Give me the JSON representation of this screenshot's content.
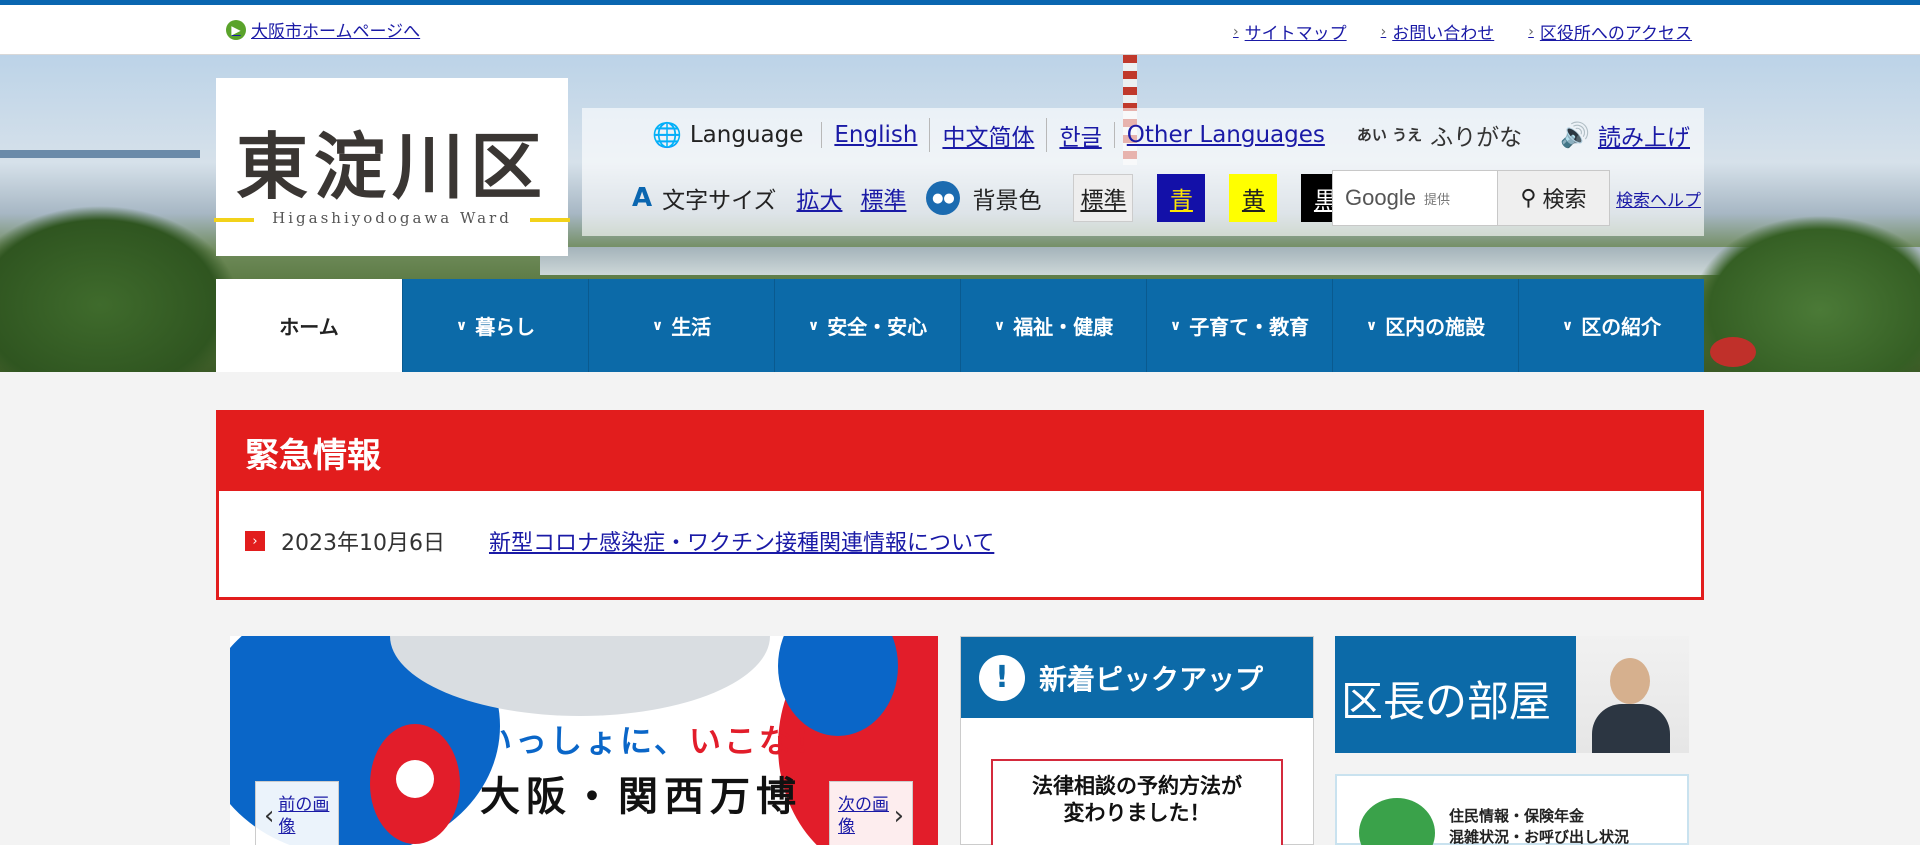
{
  "topbar": {
    "home_link": "大阪市ホームページへ",
    "links": [
      "サイトマップ",
      "お問い合わせ",
      "区役所へのアクセス"
    ]
  },
  "logo": {
    "kanji": "東淀川区",
    "roman": "Higashiyodogawa Ward"
  },
  "language": {
    "label": "Language",
    "options": [
      "English",
      "中文简体",
      "한글",
      "Other Languages"
    ],
    "furigana_icon": "あい うえ",
    "furigana": "ふりがな",
    "read_aloud": "読み上げ"
  },
  "text_size": {
    "label": "文字サイズ",
    "enlarge": "拡大",
    "standard": "標準"
  },
  "background": {
    "label": "背景色",
    "options": [
      "標準",
      "青",
      "黄",
      "黒"
    ]
  },
  "search": {
    "provider": "Google",
    "provider_suffix": "提供",
    "button": "検索",
    "help": "検索ヘルプ"
  },
  "nav": [
    "ホーム",
    "暮らし",
    "生活",
    "安全・安心",
    "福祉・健康",
    "子育て・教育",
    "区内の施設",
    "区の紹介"
  ],
  "emergency": {
    "title": "緊急情報",
    "date": "2023年10月6日",
    "link": "新型コロナ感染症・ワクチン接種関連情報について"
  },
  "slideshow": {
    "line1_a": "いっしょに、",
    "line1_b": "いこな！",
    "line2": "大阪・関西万博",
    "prev": "前の画像",
    "next": "次の画像"
  },
  "pickup": {
    "title": "新着ピックアップ",
    "card_line1": "法律相談の予約方法が",
    "card_line2": "変わりました！"
  },
  "mayor": {
    "title": "区長の部屋"
  },
  "resident": {
    "line1": "住民情報・保険年金",
    "line2": "混雑状況・お呼び出し状況"
  }
}
